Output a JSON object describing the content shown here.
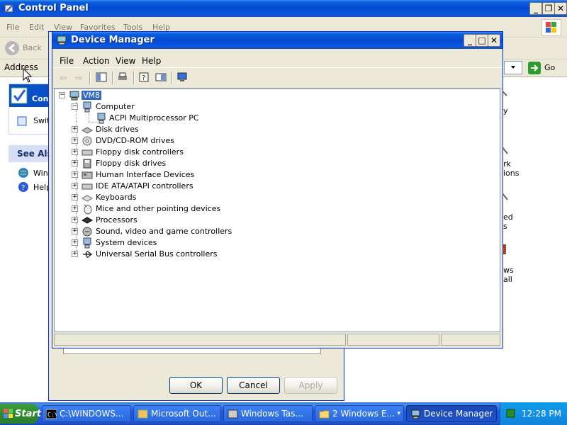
{
  "control_panel": {
    "title": "Control Panel",
    "menu": [
      "File",
      "Edit",
      "View",
      "Favorites",
      "Tools",
      "Help"
    ],
    "back_label": "Back",
    "address_label": "Address",
    "go_label": "Go",
    "task_box": {
      "item1": "Conv",
      "item2": "Swit"
    },
    "see_also": {
      "header": "See Als",
      "item1": "Win",
      "item2": "Help"
    },
    "right_fragments": [
      "y",
      "rk",
      "ions",
      "ed",
      "s",
      "ws",
      "all"
    ]
  },
  "dialog": {
    "ok_label": "OK",
    "cancel_label": "Cancel",
    "apply_label": "Apply"
  },
  "device_manager": {
    "title": "Device Manager",
    "menu": [
      "File",
      "Action",
      "View",
      "Help"
    ],
    "root": "VM8",
    "computer": "Computer",
    "computer_child": "ACPI Multiprocessor PC",
    "categories": [
      "Disk drives",
      "DVD/CD-ROM drives",
      "Floppy disk controllers",
      "Floppy disk drives",
      "Human Interface Devices",
      "IDE ATA/ATAPI controllers",
      "Keyboards",
      "Mice and other pointing devices",
      "Processors",
      "Sound, video and game controllers",
      "System devices",
      "Universal Serial Bus controllers"
    ],
    "expander_collapsed": "+",
    "expander_expanded": "−"
  },
  "taskbar": {
    "start_label": "Start",
    "tasks": [
      "C:\\WINDOWS...",
      "Microsoft Out...",
      "Windows Tas...",
      "2 Windows E...",
      "Device Manager"
    ],
    "clock": "12:28 PM"
  },
  "colors": {
    "xp_blue": "#0549d1",
    "selection": "#316ac5",
    "face": "#ece9d8"
  }
}
